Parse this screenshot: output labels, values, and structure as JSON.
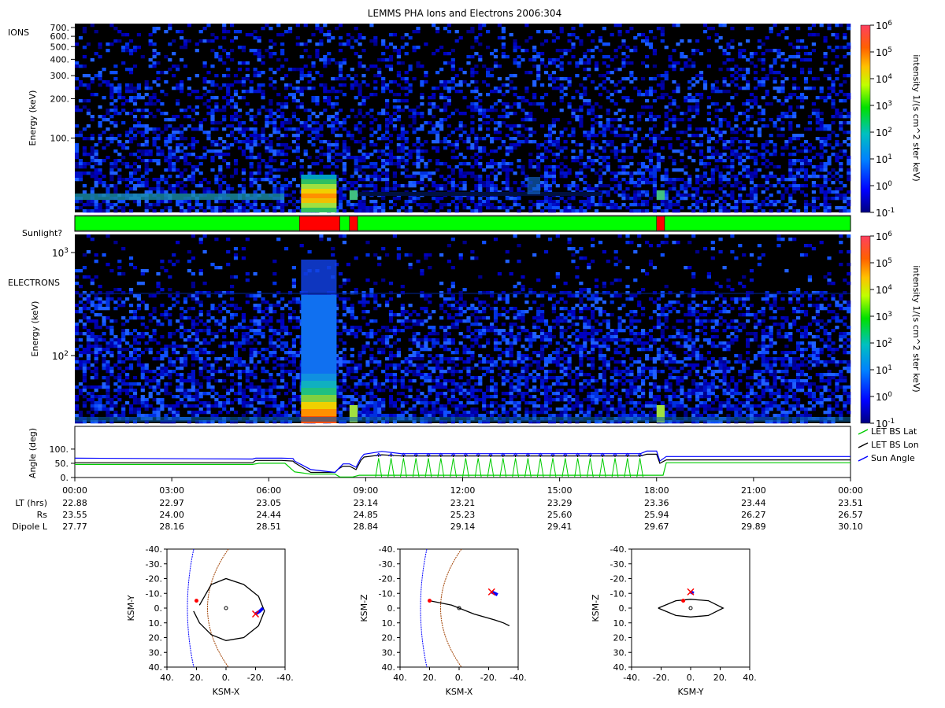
{
  "title": "LEMMS PHA Ions and Electrons  2006:304",
  "colors": {
    "sunlit": "#00ff00",
    "shadow": "#ff0000",
    "lat": "#00cc00",
    "lon": "#000000",
    "sun": "#0000ff",
    "bg_black": "#000000"
  },
  "ions_panel": {
    "label": "IONS",
    "ylabel": "Energy (keV)",
    "ticks": [
      "700.",
      "600.",
      "500.",
      "400.",
      "300.",
      "200.",
      "100."
    ],
    "tick_values": [
      700,
      600,
      500,
      400,
      300,
      200,
      100
    ],
    "yrange": [
      27,
      750
    ],
    "scale": "log"
  },
  "sunlight_bar": {
    "label": "Sunlight?",
    "segments": [
      {
        "state": "sunlit",
        "start": 0.0,
        "end": 6.95
      },
      {
        "state": "shadow",
        "start": 6.95,
        "end": 8.2
      },
      {
        "state": "sunlit",
        "start": 8.2,
        "end": 8.5
      },
      {
        "state": "shadow",
        "start": 8.5,
        "end": 8.75
      },
      {
        "state": "sunlit",
        "start": 8.75,
        "end": 18.0
      },
      {
        "state": "shadow",
        "start": 18.0,
        "end": 18.25
      },
      {
        "state": "sunlit",
        "start": 18.25,
        "end": 24.0
      }
    ]
  },
  "electrons_panel": {
    "label": "ELECTRONS",
    "ylabel": "Energy (keV)",
    "ticks": [
      "10^3",
      "10^2"
    ],
    "tick_values": [
      1000,
      100
    ],
    "yrange": [
      22,
      1500
    ],
    "scale": "log"
  },
  "colorbar": {
    "label": "intensity 1/(s cm^2 ster keV)",
    "ticks": [
      "10^6",
      "10^5",
      "10^4",
      "10^3",
      "10^2",
      "10^1",
      "10^0",
      "10^-1"
    ],
    "range": [
      0.1,
      1000000
    ],
    "scale": "log"
  },
  "angle_panel": {
    "ylabel": "Angle (deg)",
    "ticks": [
      "100.",
      "50.",
      "0."
    ],
    "tick_values": [
      100,
      50,
      0
    ],
    "yrange": [
      0,
      180
    ],
    "legend": [
      {
        "name": "LET BS Lat",
        "color": "#00cc00"
      },
      {
        "name": "LET BS Lon",
        "color": "#000000"
      },
      {
        "name": "Sun Angle",
        "color": "#0000ff"
      }
    ]
  },
  "time_axis": {
    "ticks": [
      "00:00",
      "03:00",
      "06:00",
      "09:00",
      "12:00",
      "15:00",
      "18:00",
      "21:00",
      "00:00"
    ],
    "tick_hours": [
      0,
      3,
      6,
      9,
      12,
      15,
      18,
      21,
      24
    ],
    "rows": [
      {
        "label": "LT (hrs)",
        "values": [
          "22.88",
          "22.97",
          "23.05",
          "23.14",
          "23.21",
          "23.29",
          "23.36",
          "23.44",
          "23.51"
        ]
      },
      {
        "label": "Rs",
        "values": [
          "23.55",
          "24.00",
          "24.44",
          "24.85",
          "25.23",
          "25.60",
          "25.94",
          "26.27",
          "26.57"
        ]
      },
      {
        "label": "Dipole L",
        "values": [
          "27.77",
          "28.16",
          "28.51",
          "28.84",
          "29.14",
          "29.41",
          "29.67",
          "29.89",
          "30.10"
        ]
      }
    ]
  },
  "chart_data": [
    {
      "type": "heatmap",
      "title": "LEMMS PHA Ions and Electrons  2006:304",
      "panel": "IONS",
      "ylabel": "Energy (keV)",
      "scale": "log",
      "xlim_hours": [
        0,
        24
      ],
      "enhancements": [
        {
          "start": 7.0,
          "end": 8.1,
          "peak_intensity": 10000
        },
        {
          "start": 8.5,
          "end": 8.75,
          "peak_intensity": 100
        },
        {
          "start": 18.0,
          "end": 18.25,
          "peak_intensity": 100
        }
      ]
    },
    {
      "type": "heatmap",
      "panel": "ELECTRONS",
      "ylabel": "Energy (keV)",
      "scale": "log",
      "xlim_hours": [
        0,
        24
      ],
      "enhancements": [
        {
          "start": 7.0,
          "end": 8.1,
          "peak_intensity": 100000
        },
        {
          "start": 8.5,
          "end": 8.75,
          "peak_intensity": 1000
        },
        {
          "start": 18.0,
          "end": 18.25,
          "peak_intensity": 1000
        }
      ]
    },
    {
      "type": "line",
      "ylabel": "Angle (deg)",
      "xlim_hours": [
        0,
        24
      ],
      "ylim": [
        0,
        180
      ],
      "series": [
        {
          "name": "Sun Angle",
          "x": [
            0,
            5.5,
            5.6,
            6.4,
            6.75,
            6.8,
            7.3,
            8.05,
            8.15,
            8.3,
            8.5,
            8.7,
            8.85,
            8.95,
            9.5,
            10.1,
            17.5,
            17.7,
            18.0,
            18.1,
            18.3,
            24
          ],
          "y": [
            68,
            65,
            68,
            68,
            67,
            58,
            28,
            18,
            30,
            48,
            48,
            36,
            68,
            82,
            92,
            84,
            84,
            93,
            93,
            58,
            74,
            74
          ]
        },
        {
          "name": "LET BS Lon",
          "x": [
            0,
            5.5,
            5.6,
            6.4,
            6.75,
            6.8,
            7.3,
            8.05,
            8.15,
            8.3,
            8.5,
            8.7,
            8.85,
            8.95,
            9.5,
            10.1,
            17.5,
            17.7,
            18.0,
            18.1,
            18.3,
            24
          ],
          "y": [
            52,
            52,
            60,
            60,
            58,
            52,
            18,
            18,
            30,
            40,
            40,
            28,
            60,
            72,
            80,
            76,
            76,
            82,
            82,
            50,
            62,
            62
          ]
        },
        {
          "name": "LET BS Lat",
          "x": [
            0,
            5.5,
            5.7,
            6.5,
            6.8,
            7.3,
            8.05,
            8.2,
            8.6,
            8.8,
            18.2,
            18.3,
            24
          ],
          "y": [
            46,
            46,
            50,
            50,
            20,
            12,
            12,
            2,
            2,
            8,
            8,
            52,
            52
          ]
        }
      ]
    },
    {
      "type": "scatter",
      "xlabel": "KSM-X",
      "ylabel": "KSM-Y",
      "xlim": [
        40,
        -40
      ],
      "ylim": [
        -40,
        40
      ],
      "ticks": [
        "-40.",
        "-30.",
        "-20.",
        "-10.",
        "0.",
        "10.",
        "20.",
        "30.",
        "40."
      ],
      "xticks": [
        "40.",
        "20.",
        "0.",
        "-20.",
        "-40."
      ],
      "series": [
        {
          "name": "orbit",
          "x": [
            18,
            10,
            0,
            -12,
            -22,
            -26,
            -22,
            -12,
            0,
            10,
            18,
            22
          ],
          "y": [
            -2,
            -16,
            -20,
            -16,
            -8,
            2,
            12,
            20,
            22,
            18,
            10,
            2
          ]
        },
        {
          "name": "current",
          "x": [
            -20,
            -23,
            -25
          ],
          "y": [
            4,
            2,
            0
          ]
        },
        {
          "name": "start",
          "x": [
            20
          ],
          "y": [
            -5
          ]
        }
      ]
    },
    {
      "type": "scatter",
      "xlabel": "KSM-X",
      "ylabel": "KSM-Z",
      "xlim": [
        40,
        -40
      ],
      "ylim": [
        -40,
        40
      ],
      "ticks": [
        "-40.",
        "-30.",
        "-20.",
        "-10.",
        "0.",
        "10.",
        "20.",
        "30.",
        "40."
      ],
      "xticks": [
        "40.",
        "20.",
        "0.",
        "-20.",
        "-40."
      ],
      "series": [
        {
          "name": "orbit",
          "x": [
            20,
            5,
            -10,
            -24,
            -30,
            -34
          ],
          "y": [
            -5,
            -2,
            4,
            8,
            10,
            12
          ]
        },
        {
          "name": "current",
          "x": [
            -22,
            -26
          ],
          "y": [
            -11,
            -9
          ]
        },
        {
          "name": "start",
          "x": [
            20
          ],
          "y": [
            -5
          ]
        }
      ]
    },
    {
      "type": "scatter",
      "xlabel": "KSM-Y",
      "ylabel": "KSM-Z",
      "xlim": [
        -40,
        40
      ],
      "ylim": [
        -40,
        40
      ],
      "ticks": [
        "-40.",
        "-30.",
        "-20.",
        "-10.",
        "0.",
        "10.",
        "20.",
        "30.",
        "40."
      ],
      "xticks": [
        "-40.",
        "-20.",
        "0.",
        "20.",
        "40."
      ],
      "series": [
        {
          "name": "orbit",
          "x": [
            -22,
            -10,
            0,
            12,
            22,
            12,
            0,
            -10,
            -22
          ],
          "y": [
            0,
            -5,
            -6,
            -5,
            0,
            5,
            6,
            5,
            0
          ]
        },
        {
          "name": "current",
          "x": [
            0,
            2
          ],
          "y": [
            -11,
            -10
          ]
        },
        {
          "name": "start",
          "x": [
            -5
          ],
          "y": [
            -5
          ]
        }
      ]
    }
  ],
  "orbit_plots": [
    {
      "xlabel": "KSM-X",
      "ylabel": "KSM-Y",
      "yticks": [
        "-40.",
        "-30.",
        "-20.",
        "-10.",
        "0.",
        "10.",
        "20.",
        "30.",
        "40."
      ],
      "xticks": [
        "40.",
        "20.",
        "0.",
        "-20.",
        "-40."
      ]
    },
    {
      "xlabel": "KSM-X",
      "ylabel": "KSM-Z",
      "yticks": [
        "-40.",
        "-30.",
        "-20.",
        "-10.",
        "0.",
        "10.",
        "20.",
        "30.",
        "40."
      ],
      "xticks": [
        "40.",
        "20.",
        "0.",
        "-20.",
        "-40."
      ]
    },
    {
      "xlabel": "KSM-Y",
      "ylabel": "KSM-Z",
      "yticks": [
        "-40.",
        "-30.",
        "-20.",
        "-10.",
        "0.",
        "10.",
        "20.",
        "30.",
        "40."
      ],
      "xticks": [
        "-40.",
        "-20.",
        "0.",
        "20.",
        "40."
      ]
    }
  ]
}
